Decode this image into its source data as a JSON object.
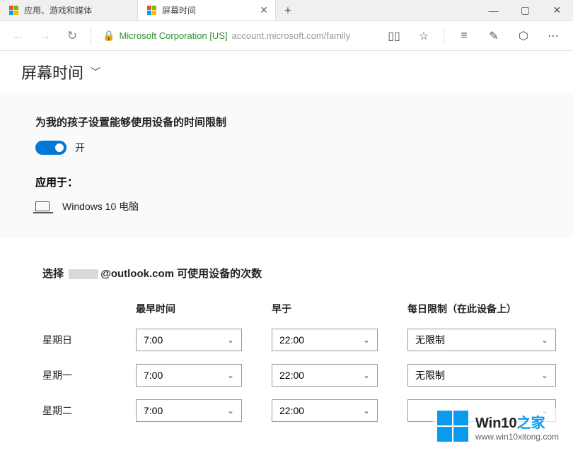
{
  "tabs": [
    {
      "title": "应用、游戏和媒体",
      "active": false
    },
    {
      "title": "屏幕时间",
      "active": true
    }
  ],
  "addressbar": {
    "certificate": "Microsoft Corporation [US]",
    "url": "account.microsoft.com/family"
  },
  "page": {
    "title": "屏幕时间"
  },
  "limits": {
    "heading": "为我的孩子设置能够使用设备的时间限制",
    "toggle_state": "开",
    "applies_heading": "应用于：",
    "device": "Windows 10 电脑"
  },
  "schedule": {
    "heading_prefix": "选择",
    "heading_email": "@outlook.com",
    "heading_suffix": " 可使用设备的次数",
    "columns": {
      "earliest": "最早时间",
      "before": "早于",
      "daily_limit": "每日限制（在此设备上）"
    },
    "rows": [
      {
        "day": "星期日",
        "from": "7:00",
        "to": "22:00",
        "limit": "无限制"
      },
      {
        "day": "星期一",
        "from": "7:00",
        "to": "22:00",
        "limit": "无限制"
      },
      {
        "day": "星期二",
        "from": "7:00",
        "to": "22:00",
        "limit": ""
      }
    ]
  },
  "watermark": {
    "title_pre": "Win10",
    "title_post": "之家",
    "url": "www.win10xitong.com"
  }
}
